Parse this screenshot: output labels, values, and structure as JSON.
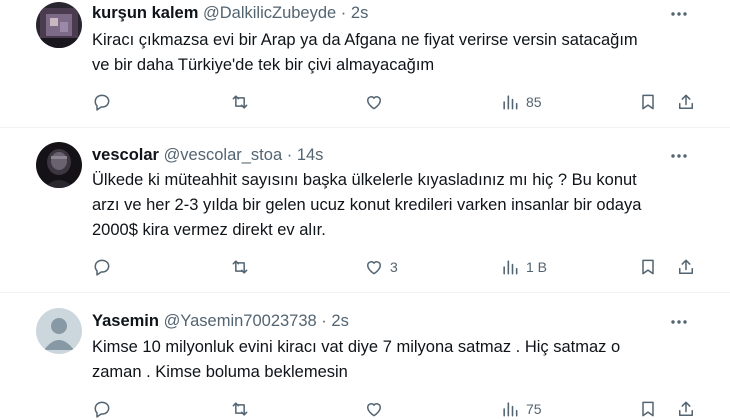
{
  "colors": {
    "text": "#0f1419",
    "muted": "#536471",
    "divider": "#eff3f4"
  },
  "tweets": [
    {
      "name": "kurşun kalem",
      "handle": "@DalkilicZubeyde",
      "dot": "·",
      "time": "2s",
      "text": "Kiracı çıkmazsa evi bir Arap ya da Afgana ne fiyat verirse versin satacağım\nve bir daha Türkiye'de tek bir çivi almayacağım",
      "replies": "",
      "retweets": "",
      "likes": "",
      "views": "85",
      "avatar_icon": "dark-photo-avatar"
    },
    {
      "name": "vescolar",
      "handle": "@vescolar_stoa",
      "dot": "·",
      "time": "14s",
      "text": "Ülkede ki müteahhit sayısını başka ülkelerle kıyasladınız mı hiç ? Bu konut\narzı ve her 2-3 yılda bir gelen ucuz konut kredileri varken insanlar bir odaya\n2000$ kira vermez direkt ev alır.",
      "replies": "",
      "retweets": "",
      "likes": "3",
      "views": "1 B",
      "avatar_icon": "dark-figure-avatar"
    },
    {
      "name": "Yasemin",
      "handle": "@Yasemin70023738",
      "dot": "·",
      "time": "2s",
      "text": "Kimse 10 milyonluk  evini kiracı vat diye 7 milyona satmaz . Hiç satmaz o\nzaman . Kimse boluma beklemesin",
      "replies": "",
      "retweets": "",
      "likes": "",
      "views": "75",
      "avatar_icon": "default-person-avatar"
    }
  ]
}
